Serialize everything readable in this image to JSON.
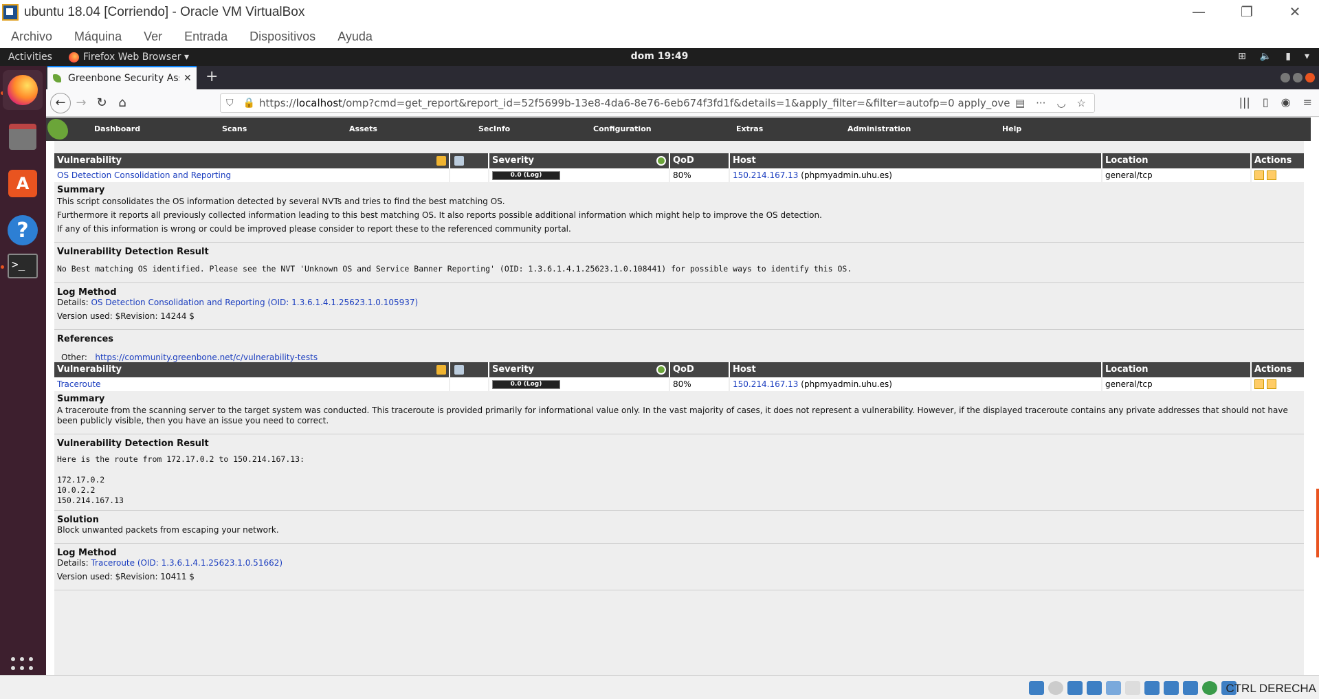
{
  "vbox": {
    "window_title": "ubuntu 18.04 [Corriendo] - Oracle VM VirtualBox",
    "menu": [
      "Archivo",
      "Máquina",
      "Ver",
      "Entrada",
      "Dispositivos",
      "Ayuda"
    ],
    "host_key": "CTRL DERECHA",
    "controls": {
      "minimize": "—",
      "restore": "❐",
      "close": "✕"
    }
  },
  "gnome": {
    "activities": "Activities",
    "app_menu": "Firefox Web Browser ▾",
    "clock": "dom 19:49"
  },
  "firefox": {
    "tab_title": "Greenbone Security Assi",
    "url_scheme": "https://",
    "url_host": "localhost",
    "url_path": "/omp?cmd=get_report&report_id=52f5699b-13e8-4da6-8e76-6eb674f3fd1f&details=1&apply_filter=&filter=autofp=0 apply_overrides=1 notes=1 ove"
  },
  "gsa_nav": [
    "Dashboard",
    "Scans",
    "Assets",
    "SecInfo",
    "Configuration",
    "Extras",
    "Administration",
    "Help"
  ],
  "table_headers": {
    "vulnerability": "Vulnerability",
    "severity": "Severity",
    "qod": "QoD",
    "host": "Host",
    "location": "Location",
    "actions": "Actions"
  },
  "results": [
    {
      "name": "OS Detection Consolidation and Reporting",
      "severity": "0.0 (Log)",
      "qod": "80%",
      "host_ip": "150.214.167.13",
      "host_name": "(phpmyadmin.uhu.es)",
      "location": "general/tcp",
      "summary_title": "Summary",
      "summary": [
        "This script consolidates the OS information detected by several NVTs and tries to find the best matching OS.",
        "Furthermore it reports all previously collected information leading to this best matching OS. It also reports possible additional information which might help to improve the OS detection.",
        "If any of this information is wrong or could be improved please consider to report these to the referenced community portal."
      ],
      "vdr_title": "Vulnerability Detection Result",
      "vdr": "No Best matching OS identified. Please see the NVT 'Unknown OS and Service Banner Reporting' (OID: 1.3.6.1.4.1.25623.1.0.108441) for possible ways to identify this OS.",
      "log_title": "Log Method",
      "log_details_label": "Details:",
      "log_details_link": "OS Detection Consolidation and Reporting (OID: 1.3.6.1.4.1.25623.1.0.105937)",
      "version": "Version used: $Revision: 14244 $",
      "refs_title": "References",
      "refs_other_label": "Other:",
      "refs_other_link": "https://community.greenbone.net/c/vulnerability-tests"
    },
    {
      "name": "Traceroute",
      "severity": "0.0 (Log)",
      "qod": "80%",
      "host_ip": "150.214.167.13",
      "host_name": "(phpmyadmin.uhu.es)",
      "location": "general/tcp",
      "summary_title": "Summary",
      "summary": [
        "A traceroute from the scanning server to the target system was conducted. This traceroute is provided primarily for informational value only. In the vast majority of cases, it does not represent a vulnerability. However, if the displayed traceroute contains any private addresses that should not have been publicly visible, then you have an issue you need to correct."
      ],
      "vdr_title": "Vulnerability Detection Result",
      "vdr": "Here is the route from 172.17.0.2 to 150.214.167.13:\n\n172.17.0.2\n10.0.2.2\n150.214.167.13",
      "solution_title": "Solution",
      "solution": "Block unwanted packets from escaping your network.",
      "log_title": "Log Method",
      "log_details_label": "Details:",
      "log_details_link": "Traceroute (OID: 1.3.6.1.4.1.25623.1.0.51662)",
      "version": "Version used: $Revision: 10411 $"
    }
  ]
}
